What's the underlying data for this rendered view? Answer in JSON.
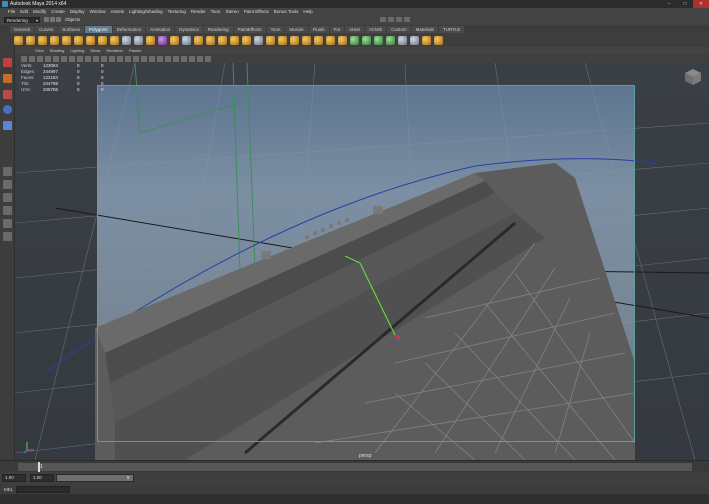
{
  "window": {
    "title": "Autodesk Maya 2014 x64",
    "minimize": "–",
    "maximize": "□",
    "close": "✕"
  },
  "menu": [
    "File",
    "Edit",
    "Modify",
    "Create",
    "Display",
    "Window",
    "Assets",
    "Lighting/Shading",
    "Texturing",
    "Render",
    "Toon",
    "Stereo",
    "Paint Effects",
    "Bonus Tools",
    "Help"
  ],
  "status_line": {
    "mode": "Rendering",
    "selection_label": "Objects"
  },
  "shelf_tabs": [
    "General",
    "Curves",
    "Surfaces",
    "Polygons",
    "Deformation",
    "Animation",
    "Dynamics",
    "Rendering",
    "PaintEffects",
    "Toon",
    "Muscle",
    "Fluids",
    "Fur",
    "nHair",
    "nCloth",
    "Custom",
    "Materials",
    "TURTLE"
  ],
  "active_shelf_tab": "Polygons",
  "panel_menu": [
    "View",
    "Shading",
    "Lighting",
    "Show",
    "Renderer",
    "Panels"
  ],
  "hud": [
    {
      "label": "Verts:",
      "v1": "123063",
      "v2": "0",
      "v3": "0"
    },
    {
      "label": "Edges:",
      "v1": "244997",
      "v2": "0",
      "v3": "0"
    },
    {
      "label": "Faces:",
      "v1": "122184",
      "v2": "0",
      "v3": "0"
    },
    {
      "label": "Tris:",
      "v1": "244788",
      "v2": "0",
      "v3": "0"
    },
    {
      "label": "UVs:",
      "v1": "205765",
      "v2": "0",
      "v3": "0"
    }
  ],
  "camera_label": "persp",
  "time_slider": {
    "current_frame": "1"
  },
  "range_slider": {
    "start": "1.00",
    "start_inner": "1.00",
    "range_num": "5"
  },
  "command_line": {
    "mode": "MEL"
  },
  "colors": {
    "viewport_bg": "#3a3f45",
    "gate_border": "#5aa0a0",
    "active_tab": "#5f7a8c",
    "curve_blue": "#2b3fa8"
  }
}
